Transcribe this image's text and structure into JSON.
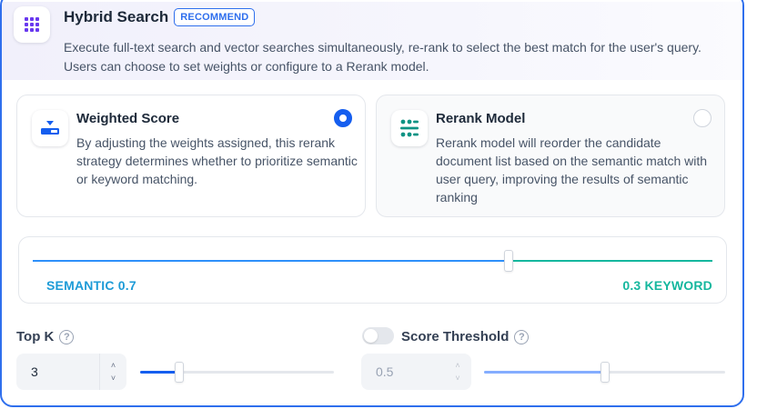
{
  "header": {
    "title": "Hybrid Search",
    "badge": "RECOMMEND",
    "description": "Execute full-text search and vector searches simultaneously, re-rank to select the best match for the user's query. Users can choose to set weights or configure to a Rerank model.",
    "icon": "grid-dots-icon"
  },
  "options": [
    {
      "title": "Weighted Score",
      "description": "By adjusting the weights assigned, this rerank strategy determines whether to prioritize semantic or keyword matching.",
      "selected": true,
      "icon": "weighted-score-icon"
    },
    {
      "title": "Rerank Model",
      "description": "Rerank model will reorder the candidate document list based on the semantic match with user query, improving the results of semantic ranking",
      "selected": false,
      "icon": "rerank-model-icon"
    }
  ],
  "weights": {
    "semantic_label": "SEMANTIC 0.7",
    "keyword_label": "0.3 KEYWORD",
    "semantic_value": 0.7,
    "keyword_value": 0.3,
    "semantic_color": "#2e90fa",
    "keyword_color": "#15b79e"
  },
  "top_k": {
    "label": "Top K",
    "value": "3",
    "slider_fraction": 0.2
  },
  "score_threshold": {
    "label": "Score Threshold",
    "value": "0.5",
    "enabled": false,
    "slider_fraction": 0.5
  },
  "colors": {
    "accent": "#155eef",
    "card_border": "#2f6fed"
  }
}
